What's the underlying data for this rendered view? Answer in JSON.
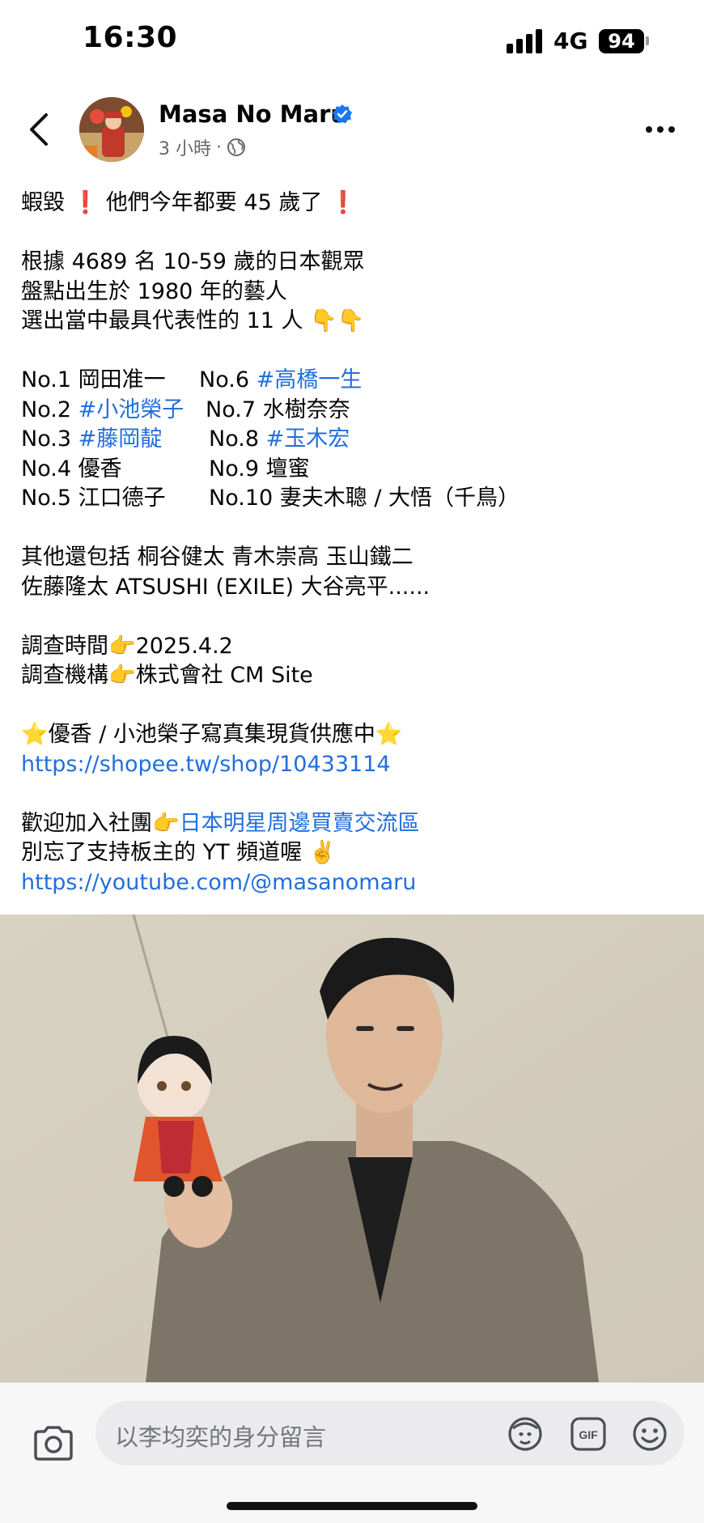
{
  "status_bar": {
    "time": "16:30",
    "network": "4G",
    "battery": "94"
  },
  "header": {
    "author_name": "Masa No Maru",
    "post_age": "3 小時",
    "separator": "·",
    "icons": [
      "back-icon",
      "verified-icon",
      "globe-icon",
      "more-icon"
    ]
  },
  "post": {
    "lines": {
      "l1": "蝦毀",
      "l1_emoji": "❗",
      "l1_rest": "他們今年都要 45 歲了",
      "l1_emoji2": "❗",
      "l2": "根據 4689 名 10-59 歲的日本觀眾",
      "l3": "盤點出生於 1980 年的藝人",
      "l4": "選出當中最具代表性的 11 人",
      "l4_emoji": "👇👇"
    },
    "ranking": [
      {
        "left": "No.1 岡田准一",
        "right_prefix": "No.6 ",
        "right_tag": "#高橋一生"
      },
      {
        "left_prefix": "No.2 ",
        "left_tag": "#小池榮子",
        "right": "No.7 水樹奈奈"
      },
      {
        "left_prefix": "No.3 ",
        "left_tag": "#藤岡靛",
        "right_prefix": "No.8 ",
        "right_tag": "#玉木宏"
      },
      {
        "left": "No.4 優香",
        "right": "No.9 壇蜜"
      },
      {
        "left": "No.5 江口德子",
        "right": "No.10 妻夫木聰 / 大悟（千鳥）"
      }
    ],
    "others_1": "其他還包括 桐谷健太 青木崇高 玉山鐵二",
    "others_2": "佐藤隆太 ATSUSHI (EXILE) 大谷亮平......",
    "survey_time_label": "調查時間",
    "survey_time": "2025.4.2",
    "survey_org_label": "調查機構",
    "survey_org": "株式會社 CM Site",
    "pointing_emoji": "👉",
    "star_emoji": "⭐",
    "photobook_text": "優香 / 小池榮子寫真集現貨供應中",
    "shop_link": "https://shopee.tw/shop/10433114",
    "group_prefix": "歡迎加入社團",
    "group_link": "日本明星周邊買賣交流區",
    "yt_text": "別忘了支持板主的 YT 頻道喔",
    "yt_emoji": "✌️",
    "yt_link": "https://youtube.com/@masanomaru"
  },
  "comment_bar": {
    "placeholder": "以李均奕的身分留言",
    "gif_label": "GIF",
    "icons": [
      "camera-icon",
      "avatar-sticker-icon",
      "gif-icon",
      "emoji-icon"
    ]
  },
  "colors": {
    "link": "#216fdb",
    "verified": "#1877f2",
    "meta": "#65676b"
  }
}
